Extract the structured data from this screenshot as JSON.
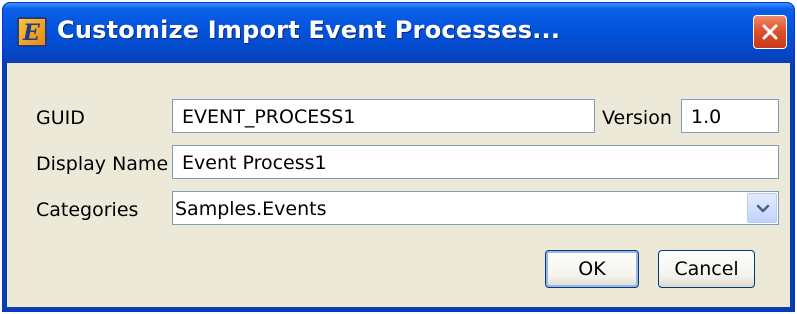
{
  "window": {
    "title": "Customize Import Event Processes...",
    "app_icon_letter": "E"
  },
  "form": {
    "guid_label": "GUID",
    "guid_value": "EVENT_PROCESS1",
    "version_label": "Version",
    "version_value": "1.0",
    "display_name_label": "Display Name",
    "display_name_value": "Event Process1",
    "categories_label": "Categories",
    "categories_value": "Samples.Events"
  },
  "buttons": {
    "ok_label": "OK",
    "cancel_label": "Cancel"
  },
  "colors": {
    "titlebar": "#0453dc",
    "dialog_bg": "#ece9d8",
    "close": "#e0522c",
    "input_border": "#7f9db9"
  },
  "icons": {
    "app": "app-logo-icon",
    "close": "close-icon",
    "dropdown": "chevron-down-icon"
  }
}
